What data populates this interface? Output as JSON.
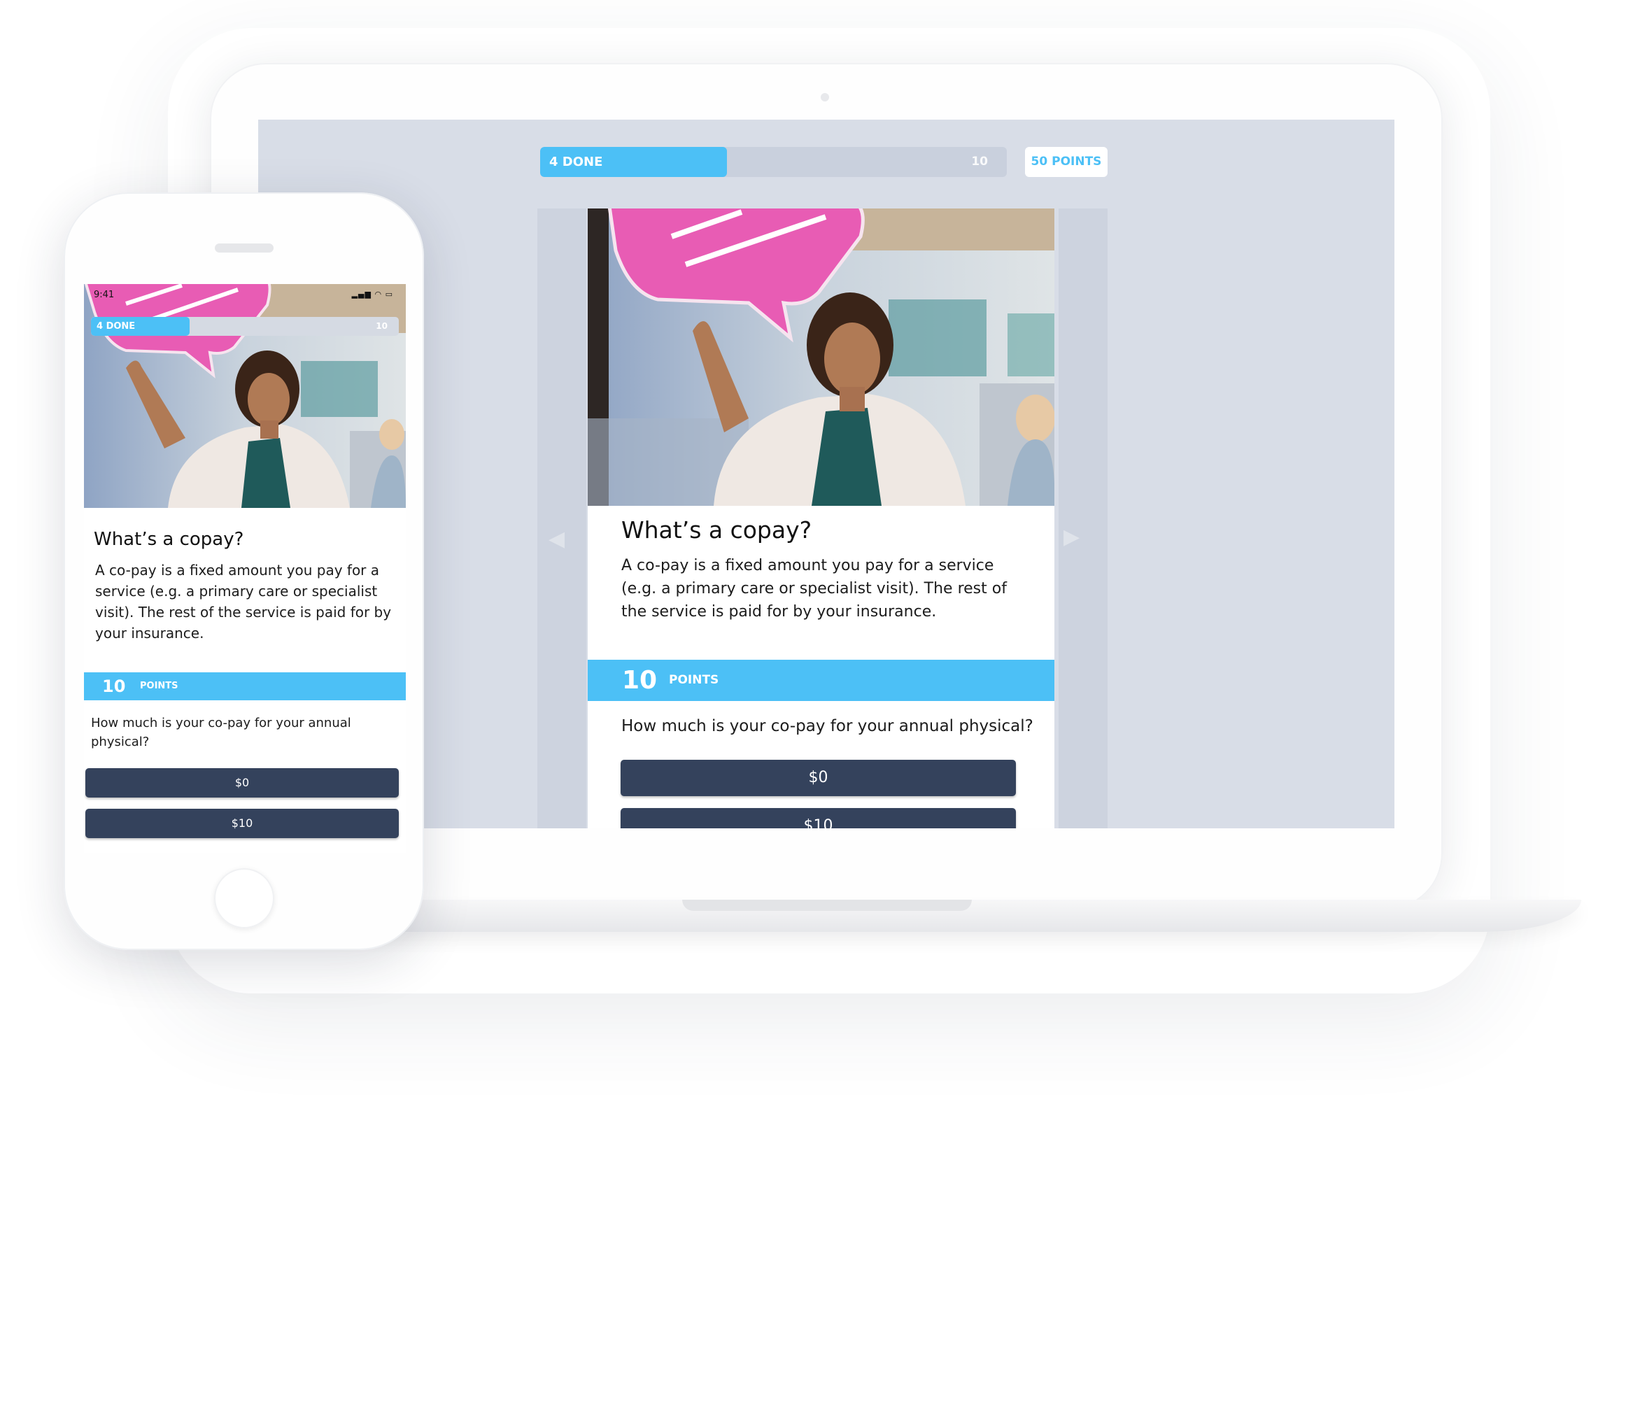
{
  "laptop": {
    "progress": {
      "done_label": "4 DONE",
      "total_label": "10",
      "fraction": 0.4
    },
    "points_badge": "50 POINTS",
    "nav": {
      "prev_icon": "triangle-left-icon",
      "next_icon": "triangle-right-icon"
    },
    "card": {
      "title": "What’s a copay?",
      "description": "A co-pay is a fixed amount you pay for a service (e.g. a primary care or specialist visit). The rest of the service is paid for by your insurance.",
      "points_value": "10",
      "points_label": "POINTS",
      "question": "How much is your co-pay for your annual physical?",
      "answers": [
        "$0",
        "$10"
      ]
    }
  },
  "phone": {
    "status_time": "9:41",
    "status_icons": "signal-icon wifi-icon battery-icon",
    "progress": {
      "done_label": "4 DONE",
      "total_label": "10",
      "fraction": 0.32
    },
    "card": {
      "title": "What’s a copay?",
      "description": "A co-pay is a fixed amount you pay for a service (e.g. a primary care or specialist visit). The rest of the service is paid for by your insurance.",
      "points_value": "10",
      "points_label": "POINTS",
      "question": "How much is your co-pay for your annual physical?",
      "answers": [
        "$0",
        "$10"
      ]
    }
  },
  "colors": {
    "accent": "#4cc0f6",
    "answer_button": "#34425c",
    "screen_background": "#d8dde7",
    "speech_bubble": "#e85cb4"
  }
}
